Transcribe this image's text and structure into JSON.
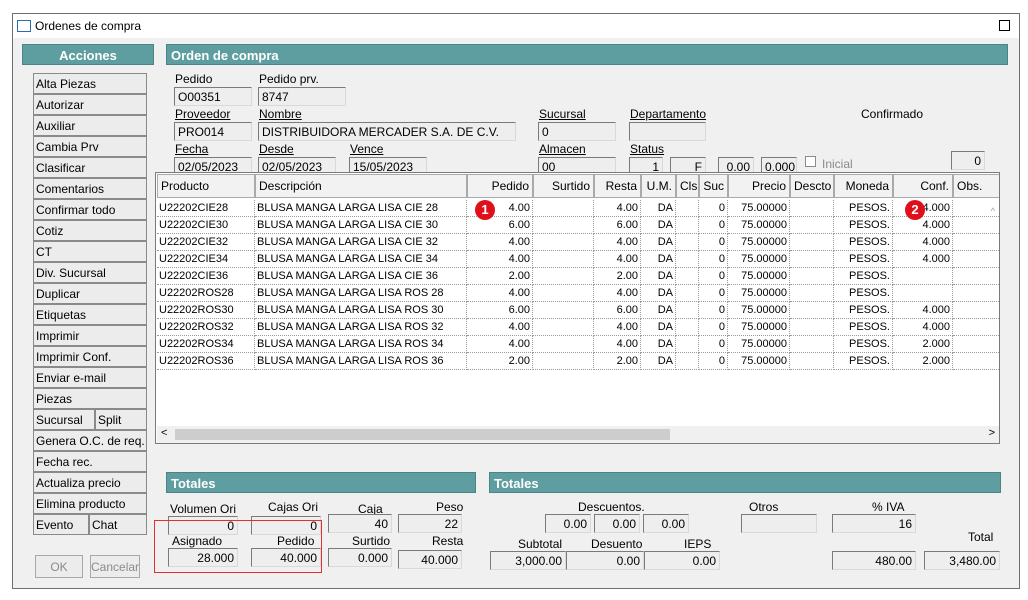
{
  "window": {
    "title": "Ordenes de compra"
  },
  "sidebar": {
    "header": "Acciones",
    "items": [
      "Alta Piezas",
      "Autorizar",
      "Auxiliar",
      "Cambia Prv",
      "Clasificar",
      "Comentarios",
      "Confirmar todo",
      "Cotiz",
      "CT",
      "Div. Sucursal",
      "Duplicar",
      "Etiquetas",
      "Imprimir",
      "Imprimir Conf.",
      "Enviar e-mail",
      "Piezas"
    ],
    "pairs": [
      [
        "Sucursal",
        "Split"
      ]
    ],
    "items2": [
      "Genera O.C. de req.",
      "Fecha rec.",
      "Actualiza precio",
      "Elimina producto"
    ],
    "pairs2": [
      [
        "Evento",
        "Chat"
      ]
    ],
    "ok_label": "OK",
    "cancel_label": "Cancelar"
  },
  "order": {
    "header": "Orden de compra",
    "pedido_label": "Pedido",
    "pedido": "O00351",
    "pedido_prv_label": "Pedido prv.",
    "pedido_prv": "8747",
    "proveedor_label": "Proveedor",
    "proveedor": "PRO014",
    "nombre_label": "Nombre",
    "nombre": "DISTRIBUIDORA MERCADER S.A. DE C.V.",
    "sucursal_label": "Sucursal",
    "sucursal": "0",
    "departamento_label": "Departamento",
    "departamento": "",
    "confirmado_label": "Confirmado",
    "fecha_label": "Fecha",
    "fecha": "02/05/2023",
    "desde_label": "Desde",
    "desde": "02/05/2023",
    "vence_label": "Vence",
    "vence": "15/05/2023",
    "almacen_label": "Almacen",
    "almacen": "00",
    "status_label": "Status",
    "status1": "1",
    "status2": "F",
    "val1": "0.00",
    "val2": "0.000",
    "inicial_label": "Inicial",
    "confirmado_value": "0"
  },
  "grid": {
    "columns": [
      "Producto",
      "Descripción",
      "Pedido",
      "Surtido",
      "Resta",
      "U.M.",
      "Cls",
      "Suc",
      "Precio",
      "Descto",
      "Moneda",
      "Conf.",
      "Obs."
    ],
    "rows": [
      [
        "U22202CIE28",
        "BLUSA MANGA LARGA LISA CIE 28",
        "4.00",
        "",
        "4.00",
        "DA",
        "",
        "0",
        "75.00000",
        "",
        "PESOS.",
        "4.000",
        ""
      ],
      [
        "U22202CIE30",
        "BLUSA MANGA LARGA LISA CIE 30",
        "6.00",
        "",
        "6.00",
        "DA",
        "",
        "0",
        "75.00000",
        "",
        "PESOS.",
        "4.000",
        ""
      ],
      [
        "U22202CIE32",
        "BLUSA MANGA LARGA LISA CIE 32",
        "4.00",
        "",
        "4.00",
        "DA",
        "",
        "0",
        "75.00000",
        "",
        "PESOS.",
        "4.000",
        ""
      ],
      [
        "U22202CIE34",
        "BLUSA MANGA LARGA LISA CIE 34",
        "4.00",
        "",
        "4.00",
        "DA",
        "",
        "0",
        "75.00000",
        "",
        "PESOS.",
        "4.000",
        ""
      ],
      [
        "U22202CIE36",
        "BLUSA MANGA LARGA LISA CIE 36",
        "2.00",
        "",
        "2.00",
        "DA",
        "",
        "0",
        "75.00000",
        "",
        "PESOS.",
        "",
        ""
      ],
      [
        "U22202ROS28",
        "BLUSA MANGA LARGA LISA ROS 28",
        "4.00",
        "",
        "4.00",
        "DA",
        "",
        "0",
        "75.00000",
        "",
        "PESOS.",
        "",
        ""
      ],
      [
        "U22202ROS30",
        "BLUSA MANGA LARGA LISA ROS 30",
        "6.00",
        "",
        "6.00",
        "DA",
        "",
        "0",
        "75.00000",
        "",
        "PESOS.",
        "4.000",
        ""
      ],
      [
        "U22202ROS32",
        "BLUSA MANGA LARGA LISA ROS 32",
        "4.00",
        "",
        "4.00",
        "DA",
        "",
        "0",
        "75.00000",
        "",
        "PESOS.",
        "4.000",
        ""
      ],
      [
        "U22202ROS34",
        "BLUSA MANGA LARGA LISA ROS 34",
        "4.00",
        "",
        "4.00",
        "DA",
        "",
        "0",
        "75.00000",
        "",
        "PESOS.",
        "2.000",
        ""
      ],
      [
        "U22202ROS36",
        "BLUSA MANGA LARGA LISA ROS 36",
        "2.00",
        "",
        "2.00",
        "DA",
        "",
        "0",
        "75.00000",
        "",
        "PESOS.",
        "2.000",
        ""
      ]
    ],
    "badge1": "1",
    "badge2": "2"
  },
  "totales_left": {
    "header": "Totales",
    "volumen_ori_label": "Volumen Ori",
    "volumen_ori": "0",
    "cajas_ori_label": "Cajas Ori",
    "cajas_ori": "0",
    "caja_label": "Caja",
    "caja": "40",
    "peso_label": "Peso",
    "peso": "22",
    "asignado_label": "Asignado",
    "asignado": "28.000",
    "pedido_label": "Pedido",
    "pedido": "40.000",
    "surtido_label": "Surtido",
    "surtido": "0.000",
    "resta_label": "Resta",
    "resta": "40.000"
  },
  "totales_right": {
    "header": "Totales",
    "descuentos_label": "Descuentos.",
    "d1": "0.00",
    "d2": "0.00",
    "d3": "0.00",
    "otros_label": "Otros",
    "otros": "",
    "iva_label": "% IVA",
    "iva": "16",
    "subtotal_label": "Subtotal",
    "subtotal": "3,000.00",
    "descuento_label": "Desuento",
    "descuento": "0.00",
    "ieps_label": "IEPS",
    "ieps": "0.00",
    "iva_amount": "480.00",
    "total_label": "Total",
    "total": "3,480.00"
  }
}
